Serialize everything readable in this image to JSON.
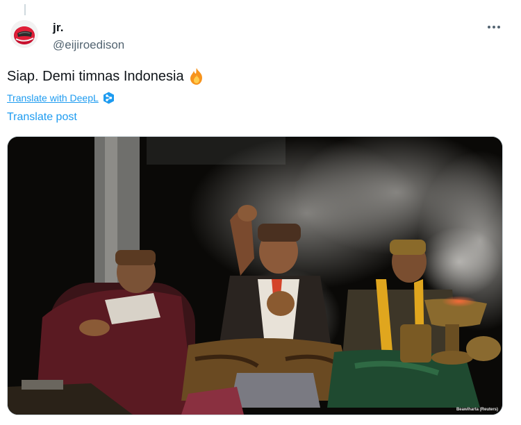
{
  "author": {
    "display_name": "jr.",
    "handle": "@eijiroedison",
    "avatar_icon": "red-helmet-avatar"
  },
  "post": {
    "text": "Siap. Demi timnas Indonesia",
    "emoji": "fire-icon"
  },
  "actions": {
    "translate_deepl": "Translate with DeepL",
    "deepl_icon": "deepl-icon",
    "translate_post": "Translate post",
    "more_icon": "more-options-icon"
  },
  "media": {
    "credit": "Beawiharta (Reuters)"
  },
  "colors": {
    "link": "#1d9bf0",
    "secondary_text": "#536471",
    "primary_text": "#0f1419",
    "divider": "#cfd9de"
  }
}
